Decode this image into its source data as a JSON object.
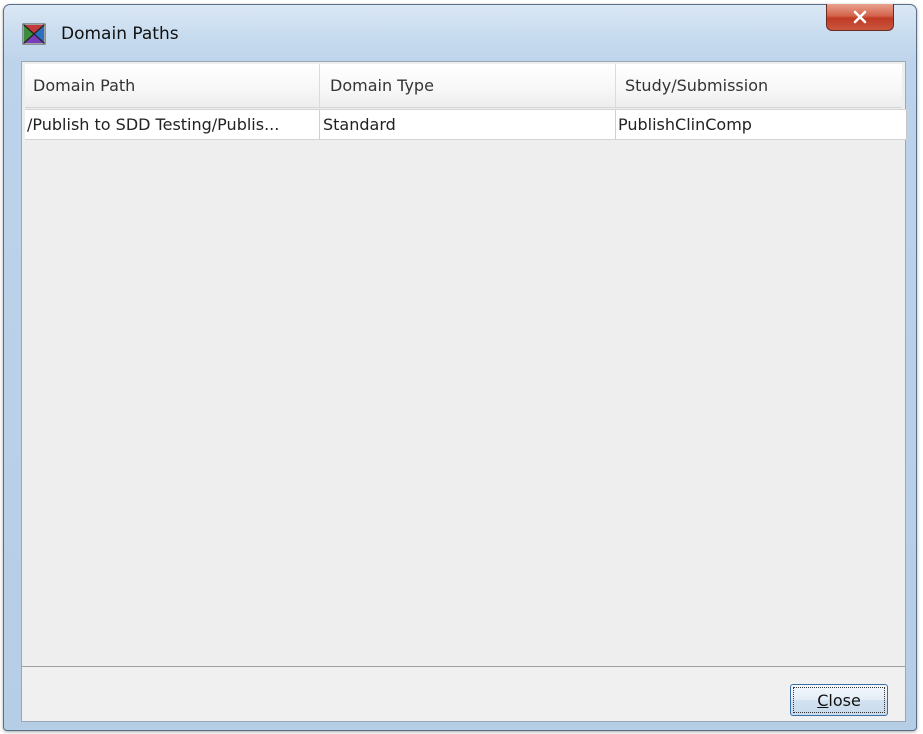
{
  "window": {
    "title": "Domain Paths",
    "title_icon": "domain-paths-app-icon",
    "close_icon": "close-x-icon"
  },
  "table": {
    "columns": [
      "Domain Path",
      "Domain Type",
      "Study/Submission"
    ],
    "rows": [
      [
        "/Publish to SDD Testing/Publis...",
        "Standard",
        "PublishClinComp"
      ]
    ]
  },
  "footer": {
    "close_label_first": "C",
    "close_label_rest": "lose"
  },
  "colors": {
    "titlebar": "#c8dcef",
    "close_button": "#c03a24",
    "client_bg": "#f0f0f0",
    "button_border": "#3a6ea8"
  }
}
